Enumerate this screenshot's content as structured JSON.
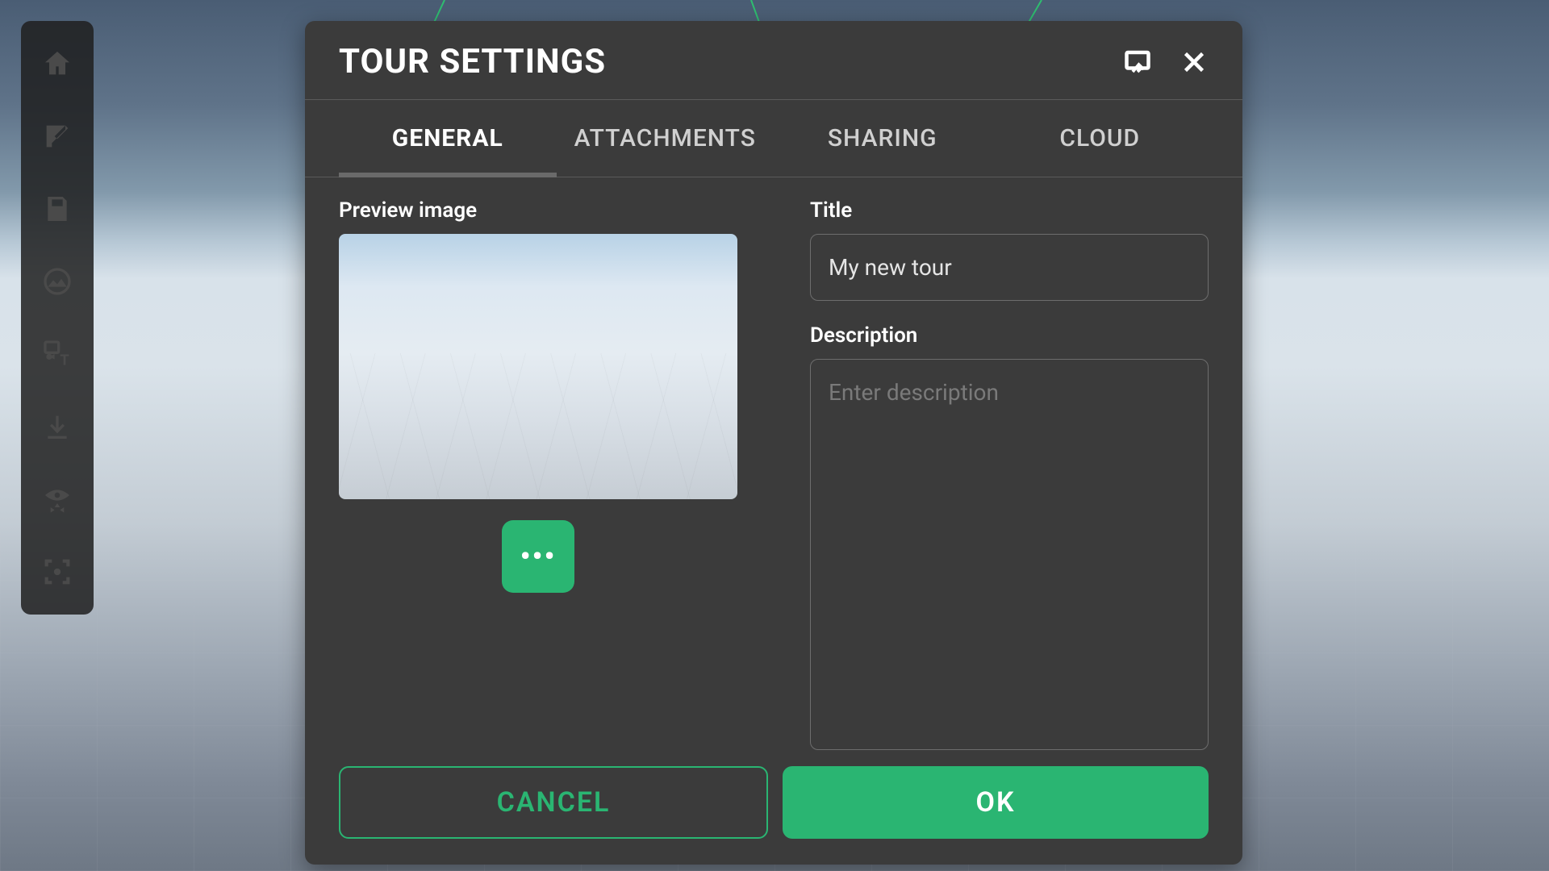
{
  "toolbar": {
    "items": [
      "home-icon",
      "edit-icon",
      "save-icon",
      "image-icon",
      "media-text-icon",
      "download-icon",
      "visibility-move-icon",
      "focus-icon"
    ]
  },
  "modal": {
    "title": "TOUR SETTINGS",
    "tabs": [
      {
        "label": "GENERAL",
        "active": true
      },
      {
        "label": "ATTACHMENTS",
        "active": false
      },
      {
        "label": "SHARING",
        "active": false
      },
      {
        "label": "CLOUD",
        "active": false
      }
    ],
    "preview_label": "Preview image",
    "more_label": "•••",
    "title_label": "Title",
    "title_value": "My new tour",
    "description_label": "Description",
    "description_placeholder": "Enter description",
    "description_value": "",
    "cancel_label": "CANCEL",
    "ok_label": "OK"
  },
  "colors": {
    "accent": "#2ab572",
    "panel": "#3b3b3b"
  }
}
